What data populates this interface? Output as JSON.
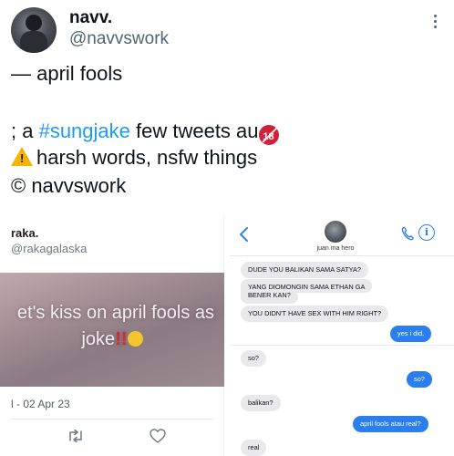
{
  "author": {
    "display_name": "navv.",
    "handle": "@navvswork"
  },
  "tweet": {
    "line1": "— april fools",
    "line2_prefix": "; a ",
    "line2_hashtag": "#sungjake",
    "line2_suffix": " few tweets au",
    "age_badge": "18",
    "line3": "harsh words, nsfw things",
    "line4": "© navvswork"
  },
  "left_media": {
    "name": "raka.",
    "handle": "@rakagalaska",
    "video_line1": "et's kiss on april fools as",
    "video_line2": "joke",
    "video_bang": "!!",
    "date": "l - 02 Apr 23"
  },
  "right_media": {
    "contact_name": "juan ma hero",
    "messages": [
      {
        "dir": "in",
        "text": "DUDE YOU BALIKAN SAMA SATYA?"
      },
      {
        "dir": "in",
        "text": "YANG DIOMONGIN SAMA ETHAN GA"
      },
      {
        "dir": "in",
        "text": "BENER KAN?"
      },
      {
        "dir": "in",
        "text": "YOU DIDN'T HAVE SEX WITH HIM RIGHT?"
      },
      {
        "dir": "out",
        "text": "yes i did."
      },
      {
        "dir": "in",
        "text": "so?"
      },
      {
        "dir": "out",
        "text": "so?"
      },
      {
        "dir": "in",
        "text": "balikan?"
      },
      {
        "dir": "out",
        "text": "april fools atau real?"
      },
      {
        "dir": "in",
        "text": "real"
      }
    ]
  },
  "icons": [
    "more-icon",
    "warning-icon",
    "age-restriction-icon",
    "retweet-icon",
    "heart-icon",
    "back-icon",
    "phone-icon",
    "info-icon"
  ],
  "colors": {
    "hashtag": "#1d9bf0",
    "imessage_blue": "#2a7ef0",
    "incoming_bubble": "#e9e9eb",
    "age_badge": "#d2203a"
  }
}
